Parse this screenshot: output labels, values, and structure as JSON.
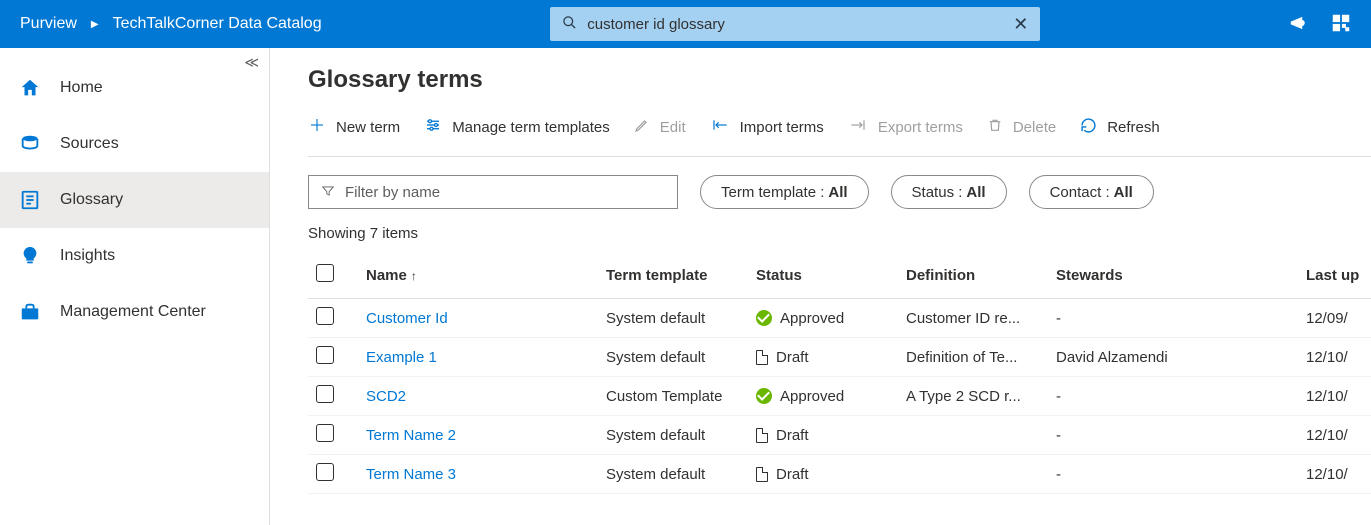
{
  "topbar": {
    "breadcrumb_root": "Purview",
    "breadcrumb_current": "TechTalkCorner Data Catalog",
    "search_value": "customer id glossary"
  },
  "sidebar": {
    "items": [
      {
        "label": "Home"
      },
      {
        "label": "Sources"
      },
      {
        "label": "Glossary"
      },
      {
        "label": "Insights"
      },
      {
        "label": "Management Center"
      }
    ]
  },
  "page": {
    "title": "Glossary terms",
    "showing": "Showing 7 items"
  },
  "toolbar": {
    "new_term": "New term",
    "manage": "Manage term templates",
    "edit": "Edit",
    "import": "Import terms",
    "export": "Export terms",
    "delete": "Delete",
    "refresh": "Refresh"
  },
  "filters": {
    "filter_placeholder": "Filter by name",
    "pill1_label": "Term template : ",
    "pill1_value": "All",
    "pill2_label": "Status : ",
    "pill2_value": "All",
    "pill3_label": "Contact : ",
    "pill3_value": "All"
  },
  "columns": {
    "name": "Name",
    "template": "Term template",
    "status": "Status",
    "definition": "Definition",
    "stewards": "Stewards",
    "lastup": "Last up"
  },
  "rows": [
    {
      "name": "Customer Id",
      "template": "System default",
      "status": "Approved",
      "status_kind": "approved",
      "definition": "Customer ID re...",
      "stewards": "-",
      "lastup": "12/09/"
    },
    {
      "name": "Example 1",
      "template": "System default",
      "status": "Draft",
      "status_kind": "draft",
      "definition": "Definition of Te...",
      "stewards": "David Alzamendi",
      "lastup": "12/10/"
    },
    {
      "name": "SCD2",
      "template": "Custom Template",
      "status": "Approved",
      "status_kind": "approved",
      "definition": "A Type 2 SCD r...",
      "stewards": "-",
      "lastup": "12/10/"
    },
    {
      "name": "Term Name 2",
      "template": "System default",
      "status": "Draft",
      "status_kind": "draft",
      "definition": "",
      "stewards": "-",
      "lastup": "12/10/"
    },
    {
      "name": "Term Name 3",
      "template": "System default",
      "status": "Draft",
      "status_kind": "draft",
      "definition": "",
      "stewards": "-",
      "lastup": "12/10/"
    }
  ]
}
